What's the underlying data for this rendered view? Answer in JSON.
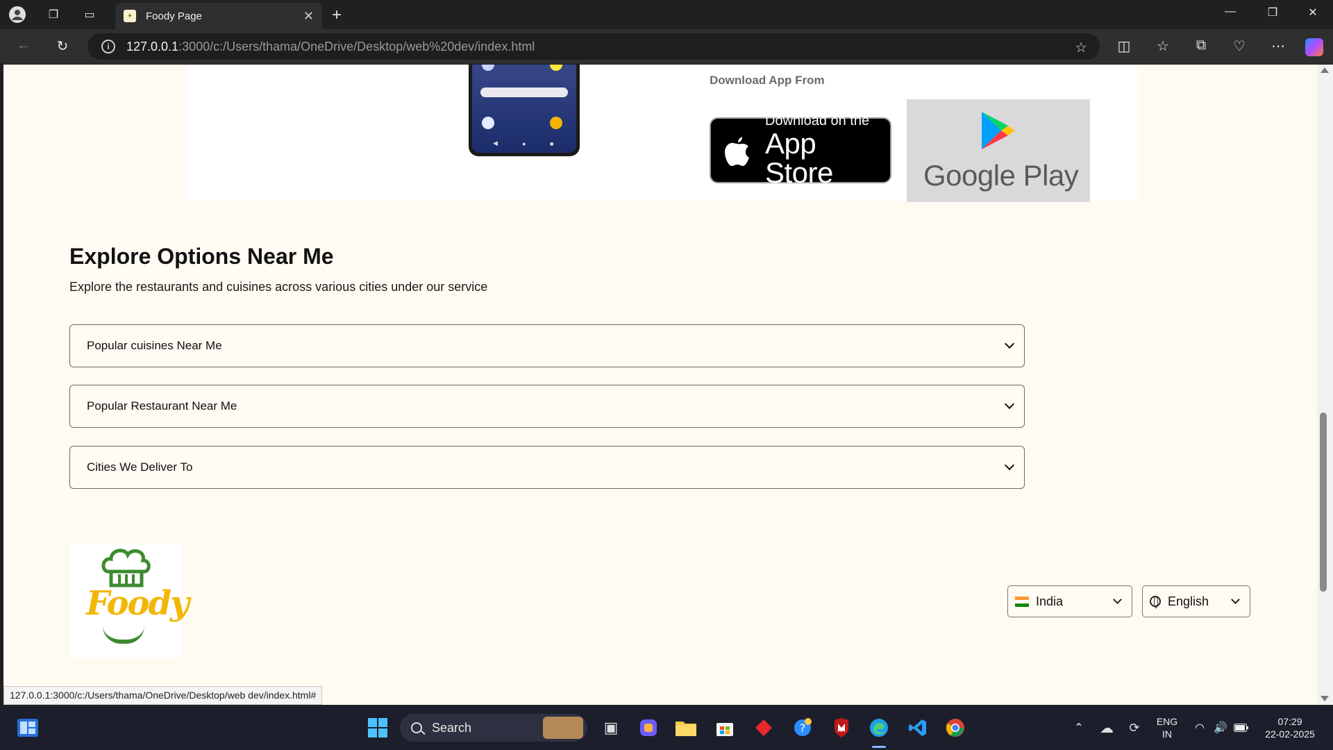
{
  "browser": {
    "tab_title": "Foody Page",
    "url_host": "127.0.0.1",
    "url_path": ":3000/c:/Users/thama/OneDrive/Desktop/web%20dev/index.html",
    "status_url": "127.0.0.1:3000/c:/Users/thama/OneDrive/Desktop/web dev/index.html#"
  },
  "app_section": {
    "download_label": "Download App From",
    "appstore_line1": "Download on the",
    "appstore_line2": "App Store",
    "googleplay_text": "Google Play"
  },
  "explore": {
    "title": "Explore Options Near Me",
    "subtitle": "Explore the restaurants and cuisines across various cities under our service",
    "options": [
      {
        "label": "Popular cuisines Near Me"
      },
      {
        "label": "Popular Restaurant Near Me"
      },
      {
        "label": "Cities We Deliver To"
      }
    ]
  },
  "footer": {
    "logo_text": "Foody",
    "country": "India",
    "language": "English"
  },
  "taskbar": {
    "search_label": "Search",
    "lang_line1": "ENG",
    "lang_line2": "IN",
    "time": "07:29",
    "date": "22-02-2025"
  },
  "colors": {
    "page_bg": "#fffaf2",
    "logo_green": "#3d8b2f",
    "logo_yellow": "#f2b705"
  }
}
